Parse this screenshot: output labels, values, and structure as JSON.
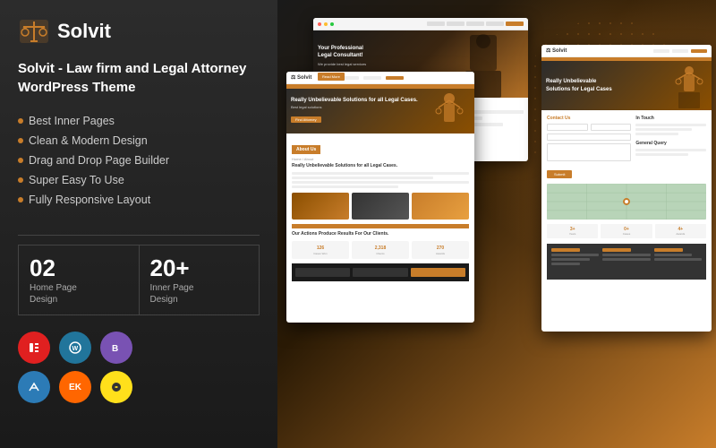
{
  "logo": {
    "text": "Solvit",
    "icon": "⚖"
  },
  "product": {
    "title": "Solvit - Law firm and Legal Attorney WordPress Theme"
  },
  "features": [
    "Best Inner Pages",
    "Clean & Modern Design",
    "Drag and Drop Page Builder",
    "Super Easy To Use",
    "Fully Responsive Layout"
  ],
  "stats": [
    {
      "number": "02",
      "label": "Home Page\nDesign"
    },
    {
      "number": "20+",
      "label": "Inner Page\nDesign"
    }
  ],
  "tech_icons": [
    {
      "name": "Elementor",
      "short": "E",
      "color_class": "icon-elementor"
    },
    {
      "name": "WordPress",
      "short": "W",
      "color_class": "icon-wordpress"
    },
    {
      "name": "Bootstrap",
      "short": "B",
      "color_class": "icon-bootstrap"
    },
    {
      "name": "Avada",
      "short": "A",
      "color_class": "icon-avada"
    },
    {
      "name": "EK",
      "short": "EK",
      "color_class": "icon-ek"
    },
    {
      "name": "Mailchimp",
      "short": "M",
      "color_class": "icon-mailchimp"
    }
  ],
  "screenshots": {
    "main": {
      "hero_title": "Your Professional\nLegal Consultant!",
      "hero_sub": "We provide best legal services",
      "hero_btn": "Read More"
    },
    "second": {
      "about_label": "About Us",
      "section_title": "Really Unbelievable Solutions for all Legal Cases."
    },
    "third": {
      "hero_title": "Really Unbelievable\nSolutions for Legal Cases",
      "contact_title": "Contact Us",
      "touch_title": "In Touch",
      "query_title": "General Query"
    }
  },
  "colors": {
    "accent": "#c87d2a",
    "dark": "#1a1a1a",
    "panel_bg": "#2c2c2c"
  }
}
